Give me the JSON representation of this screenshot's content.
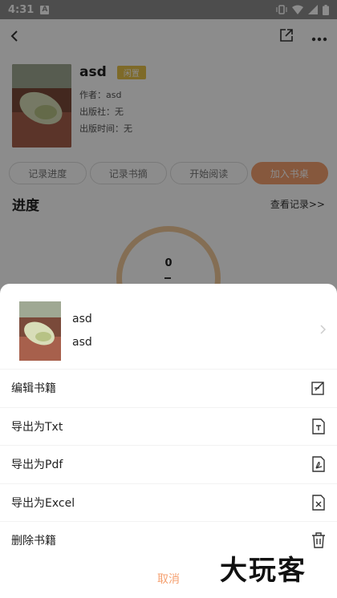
{
  "status_bar": {
    "time": "4:31",
    "notif": "A"
  },
  "top_bar": {
    "back_icon": "back-arrow-icon",
    "share_icon": "share-icon",
    "more_icon": "more-dots-icon"
  },
  "book": {
    "title": "asd",
    "badge": "闲置",
    "author": "作者：asd",
    "publisher": "出版社：无",
    "pub_date": "出版时间：无"
  },
  "actions": {
    "record_progress": "记录进度",
    "record_note": "记录书摘",
    "start_reading": "开始阅读",
    "add_to_shelf": "加入书桌"
  },
  "progress": {
    "title": "进度",
    "view_records": "查看记录>>",
    "value": "0"
  },
  "sheet": {
    "book_title": "asd",
    "book_author": "asd",
    "menu": [
      {
        "label": "编辑书籍",
        "icon": "edit-icon"
      },
      {
        "label": "导出为Txt",
        "icon": "txt-file-icon"
      },
      {
        "label": "导出为Pdf",
        "icon": "pdf-file-icon"
      },
      {
        "label": "导出为Excel",
        "icon": "excel-file-icon"
      },
      {
        "label": "删除书籍",
        "icon": "trash-icon"
      }
    ],
    "cancel": "取消"
  },
  "watermark": "大玩客",
  "colors": {
    "accent": "#f5a070",
    "badge": "#e6c14a"
  }
}
